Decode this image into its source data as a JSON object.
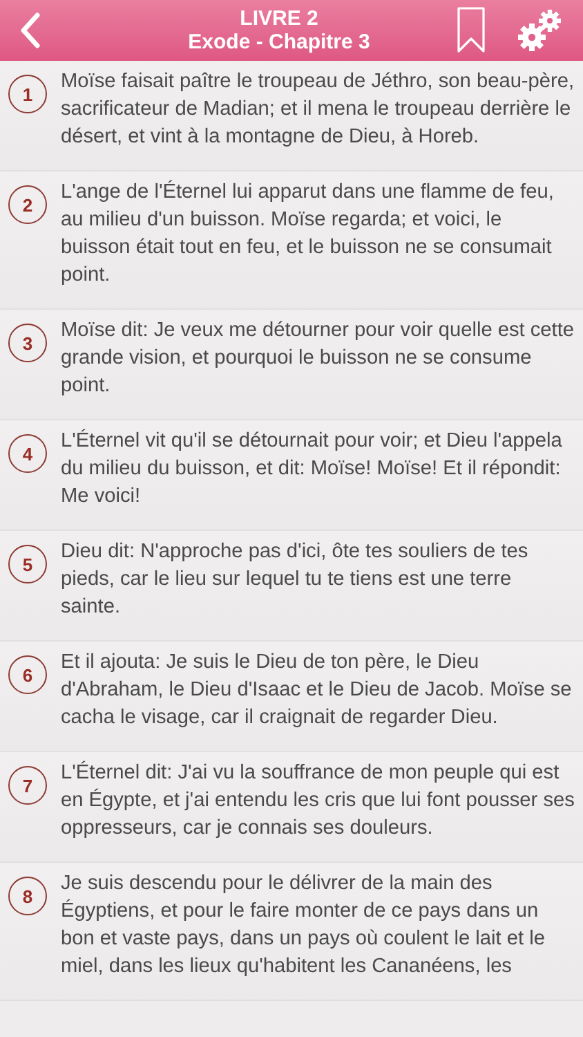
{
  "header": {
    "title": "LIVRE 2",
    "subtitle": "Exode - Chapitre 3"
  },
  "verses": [
    {
      "number": "1",
      "text": "Moïse faisait paître le troupeau de Jéthro, son beau-père, sacrificateur de Madian; et il mena le troupeau derrière le désert, et vint à la montagne de Dieu, à Horeb."
    },
    {
      "number": "2",
      "text": "L'ange de l'Éternel lui apparut dans une flamme de feu, au milieu d'un buisson. Moïse regarda; et voici, le buisson était tout en feu, et le buisson ne se consumait point."
    },
    {
      "number": "3",
      "text": "Moïse dit: Je veux me détourner pour voir quelle est cette grande vision, et pourquoi le buisson ne se consume point."
    },
    {
      "number": "4",
      "text": "L'Éternel vit qu'il se détournait pour voir; et Dieu l'appela du milieu du buisson, et dit: Moïse! Moïse! Et il répondit: Me voici!"
    },
    {
      "number": "5",
      "text": "Dieu dit: N'approche pas d'ici, ôte tes souliers de tes pieds, car le lieu sur lequel tu te tiens est une terre sainte."
    },
    {
      "number": "6",
      "text": "Et il ajouta: Je suis le Dieu de ton père, le Dieu d'Abraham, le Dieu d'Isaac et le Dieu de Jacob. Moïse se cacha le visage, car il craignait de regarder Dieu."
    },
    {
      "number": "7",
      "text": "L'Éternel dit: J'ai vu la souffrance de mon peuple qui est en Égypte, et j'ai entendu les cris que lui font pousser ses oppresseurs, car je connais ses douleurs."
    },
    {
      "number": "8",
      "text": "Je suis descendu pour le délivrer de la main des Égyptiens, et pour le faire monter de ce pays dans un bon et vaste pays, dans un pays où coulent le lait et le miel, dans les lieux qu'habitent les Cananéens, les"
    }
  ]
}
